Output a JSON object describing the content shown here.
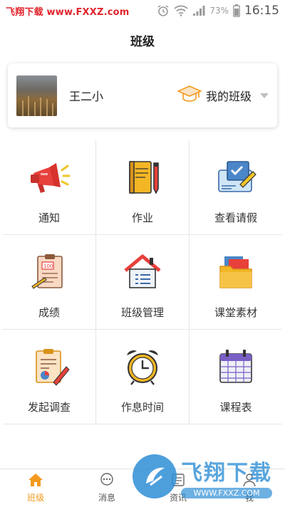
{
  "status_bar": {
    "watermark": "飞翔下载 www.FXXZ.com",
    "battery_percent": "73%",
    "time": "16:15"
  },
  "header": {
    "title": "班级"
  },
  "class_card": {
    "class_name": "王二小",
    "my_class_label": "我的班级"
  },
  "grid": [
    {
      "label": "通知",
      "icon": "megaphone-icon"
    },
    {
      "label": "作业",
      "icon": "notebook-icon"
    },
    {
      "label": "查看请假",
      "icon": "leave-form-icon"
    },
    {
      "label": "成绩",
      "icon": "score-sheet-icon"
    },
    {
      "label": "班级管理",
      "icon": "house-list-icon"
    },
    {
      "label": "课堂素材",
      "icon": "folder-icon"
    },
    {
      "label": "发起调查",
      "icon": "survey-icon"
    },
    {
      "label": "作息时间",
      "icon": "alarm-clock-icon"
    },
    {
      "label": "课程表",
      "icon": "calendar-icon"
    }
  ],
  "bottom_nav": [
    {
      "label": "班级",
      "icon": "home-icon",
      "active": true
    },
    {
      "label": "消息",
      "icon": "chat-icon",
      "active": false
    },
    {
      "label": "资讯",
      "icon": "news-icon",
      "active": false
    },
    {
      "label": "我",
      "icon": "profile-icon",
      "active": false
    }
  ],
  "bottom_watermark": {
    "title": "飞翔下载",
    "url": "WWW.FXXZ.COM"
  },
  "colors": {
    "accent": "#f39a1e",
    "watermark_red": "#e0242b",
    "watermark_blue": "#2f8fd6"
  }
}
